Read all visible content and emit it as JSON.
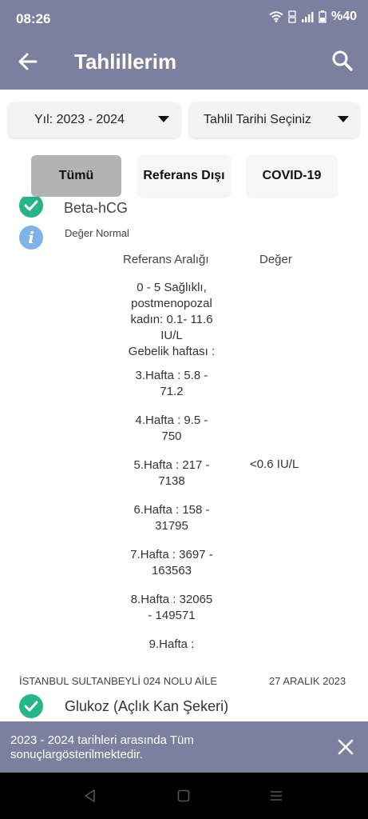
{
  "status_bar": {
    "time": "08:26",
    "battery": "%40",
    "icons": [
      "wifi-icon",
      "volte-icon",
      "signal-icon",
      "battery-icon"
    ]
  },
  "app_bar": {
    "title": "Tahlillerim",
    "back_icon": "arrow-left-icon",
    "search_icon": "search-icon"
  },
  "filters": {
    "year_dropdown": "Yıl: 2023 - 2024",
    "date_dropdown": "Tahlil Tarihi Seçiniz",
    "tabs": [
      {
        "label": "Tümü",
        "active": true
      },
      {
        "label": "Referans Dışı",
        "active": false
      },
      {
        "label": "COVID-19",
        "active": false
      }
    ]
  },
  "result": {
    "test_name": "Beta-hCG",
    "status_text": "Değer Normal",
    "column_reference": "Referans Aralığı",
    "column_value": "Değer",
    "reference_lines": [
      [
        "0 - 5 Sağlıklı,",
        "postmenopozal",
        "kadın: 0.1- 11.6",
        "IU/L",
        "Gebelik haftası :"
      ],
      [
        "3.Hafta  :   5.8 -",
        "71.2"
      ],
      [
        "4.Hafta  :  9.5 -",
        "750"
      ],
      [
        "5.Hafta  :  217 -",
        "7138"
      ],
      [
        "6.Hafta  :  158 -",
        "31795"
      ],
      [
        "7.Hafta  :  3697 -",
        "163563"
      ],
      [
        "8.Hafta  :  32065",
        "- 149571"
      ],
      [
        "9.Hafta   :"
      ]
    ],
    "value": "<0.6 IU/L"
  },
  "next_result": {
    "lab": "İSTANBUL SULTANBEYLİ 024 NOLU AİLE",
    "date": "27 ARALIK 2023",
    "test_name": "Glukoz (Açlık Kan Şekeri)"
  },
  "snackbar": {
    "message": "2023 - 2024 tarihleri arasında Tüm sonuçlargösterilmektedir.",
    "close_icon": "close-icon"
  },
  "nav_bar": {
    "icons": [
      "back-triangle-icon",
      "home-square-icon",
      "recents-menu-icon"
    ]
  },
  "colors": {
    "primary": "#7a809e",
    "check": "#26b589",
    "info": "#7fb3e5",
    "active_tab": "#b3b3b3"
  }
}
